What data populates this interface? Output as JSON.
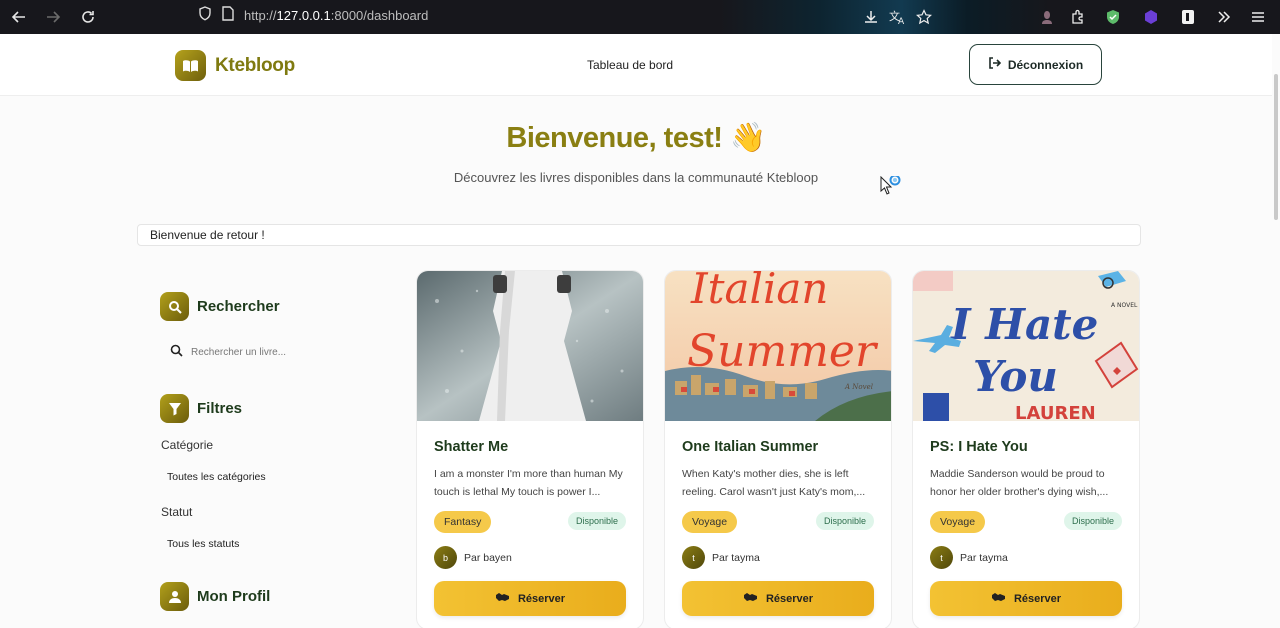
{
  "browser": {
    "url_prefix": "http://",
    "url_host": "127.0.0.1",
    "url_path": ":8000/dashboard"
  },
  "header": {
    "brand": "Ktebloop",
    "nav_link": "Tableau de bord",
    "logout_label": "Déconnexion"
  },
  "hero": {
    "title": "Bienvenue, test!",
    "emoji": "👋",
    "subtitle": "Découvrez les livres disponibles dans la communauté Ktebloop"
  },
  "alert": "Bienvenue de retour !",
  "sidebar": {
    "search_title": "Rechercher",
    "search_placeholder": "Rechercher un livre...",
    "filters_title": "Filtres",
    "category_label": "Catégorie",
    "category_value": "Toutes les catégories",
    "status_label": "Statut",
    "status_value": "Tous les statuts",
    "profile_title": "Mon Profil"
  },
  "books": [
    {
      "title": "Shatter Me",
      "description": "I am a monster I'm more than human My touch is lethal My touch is power I...",
      "genre": "Fantasy",
      "status": "Disponible",
      "owner_initial": "b",
      "owner": "Par bayen",
      "button": "Réserver"
    },
    {
      "title": "One Italian Summer",
      "description": "When Katy's mother dies, she is left reeling. Carol wasn't just Katy's mom,...",
      "genre": "Voyage",
      "status": "Disponible",
      "owner_initial": "t",
      "owner": "Par tayma",
      "button": "Réserver",
      "cover_text": [
        "Italian",
        "Summer",
        "A Novel"
      ]
    },
    {
      "title": "PS: I Hate You",
      "description": "Maddie Sanderson would be proud to honor her older brother's dying wish,...",
      "genre": "Voyage",
      "status": "Disponible",
      "owner_initial": "t",
      "owner": "Par tayma",
      "button": "Réserver",
      "cover_text": [
        "I Hate",
        "You",
        "A NOVEL",
        "LAUREN"
      ]
    }
  ],
  "colors": {
    "brand": "#7f7a10",
    "accent_button": "#f3c233",
    "heading_green": "#1e3b1c"
  }
}
